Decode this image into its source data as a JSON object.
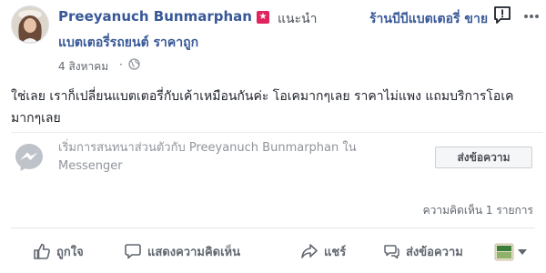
{
  "post": {
    "author": "Preeyanuch Bunmarphan",
    "recommend_label": "แนะนำ",
    "page_name_line1": "ร้านบีบีแบตเตอรี่ ขาย",
    "page_name_line2": "แบตเตอรี่รถยนต์ ราคาถูก",
    "date": "4 สิงหาคม",
    "dot": "·",
    "text": "ใช่เลย เราก็เปลี่ยนแบตเตอรี่กับเค้าเหมือนกันค่ะ โอเคมากๆเลย ราคาไม่แพง แถมบริการโอเคมากๆเลย"
  },
  "messenger_prompt": {
    "text": "เริ่มการสนทนาส่วนตัวกับ Preeyanuch Bunmarphan ใน Messenger",
    "button_label": "ส่งข้อความ"
  },
  "comment_count": "ความคิดเห็น 1 รายการ",
  "actions": {
    "like": "ถูกใจ",
    "comment": "แสดงความคิดเห็น",
    "share": "แชร์",
    "send": "ส่งข้อความ"
  },
  "colors": {
    "link_blue": "#385898",
    "badge_red": "#e0245e",
    "gray_text": "#606770"
  },
  "icons": [
    "avatar",
    "star-badge-icon",
    "globe-icon",
    "flag-icon",
    "more-options-icon",
    "messenger-icon",
    "like-icon",
    "comment-icon",
    "share-icon",
    "send-message-icon",
    "reaction-avatar-icon",
    "caret-down-icon"
  ]
}
